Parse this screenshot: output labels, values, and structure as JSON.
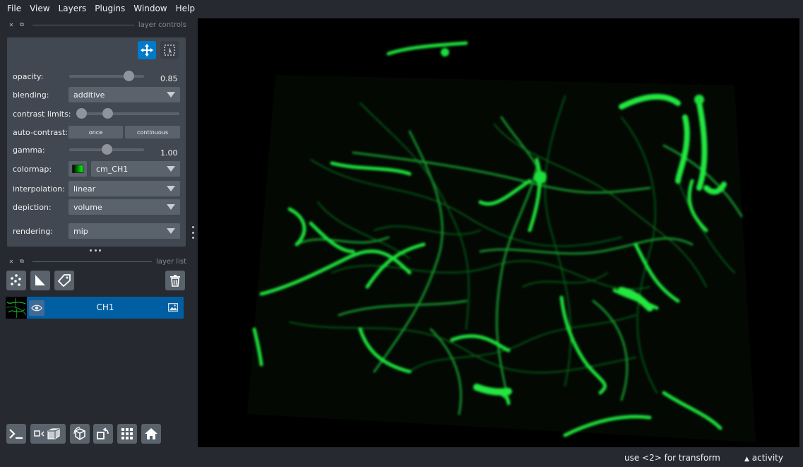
{
  "menu": [
    "File",
    "View",
    "Layers",
    "Plugins",
    "Window",
    "Help"
  ],
  "dock": {
    "controls_title": "layer controls",
    "list_title": "layer list"
  },
  "controls": {
    "opacity": {
      "label": "opacity:",
      "value": "0.85",
      "fraction": 0.85
    },
    "blending": {
      "label": "blending:",
      "value": "additive"
    },
    "contrast": {
      "label": "contrast limits:",
      "low_fraction": 0.0,
      "high_fraction": 0.28
    },
    "auto_contrast": {
      "label": "auto-contrast:",
      "once": "once",
      "continuous": "continuous"
    },
    "gamma": {
      "label": "gamma:",
      "value": "1.00",
      "fraction": 0.5
    },
    "colormap": {
      "label": "colormap:",
      "value": "cm_CH1"
    },
    "interpolation": {
      "label": "interpolation:",
      "value": "linear"
    },
    "depiction": {
      "label": "depiction:",
      "value": "volume"
    },
    "rendering": {
      "label": "rendering:",
      "value": "mip"
    }
  },
  "layers": [
    {
      "name": "CH1",
      "selected": true,
      "visible": true
    }
  ],
  "status": {
    "hint": "use <2> for transform",
    "activity": "activity"
  },
  "colors": {
    "background": "#262930",
    "panel": "#414851",
    "accent": "#007acc",
    "selected_layer": "#005fa3",
    "vessel": "#1fe03a"
  },
  "icons": {
    "move": "move-arrows-icon",
    "transform": "transform-icon",
    "new_points": "points-icon",
    "new_shapes": "shapes-icon",
    "new_labels": "labels-tag-icon",
    "delete": "trash-icon",
    "console": "console-icon",
    "ndisplay": "ndisplay-3d-icon",
    "roll": "roll-dims-icon",
    "transpose": "transpose-icon",
    "grid": "grid-icon",
    "home": "home-icon"
  }
}
